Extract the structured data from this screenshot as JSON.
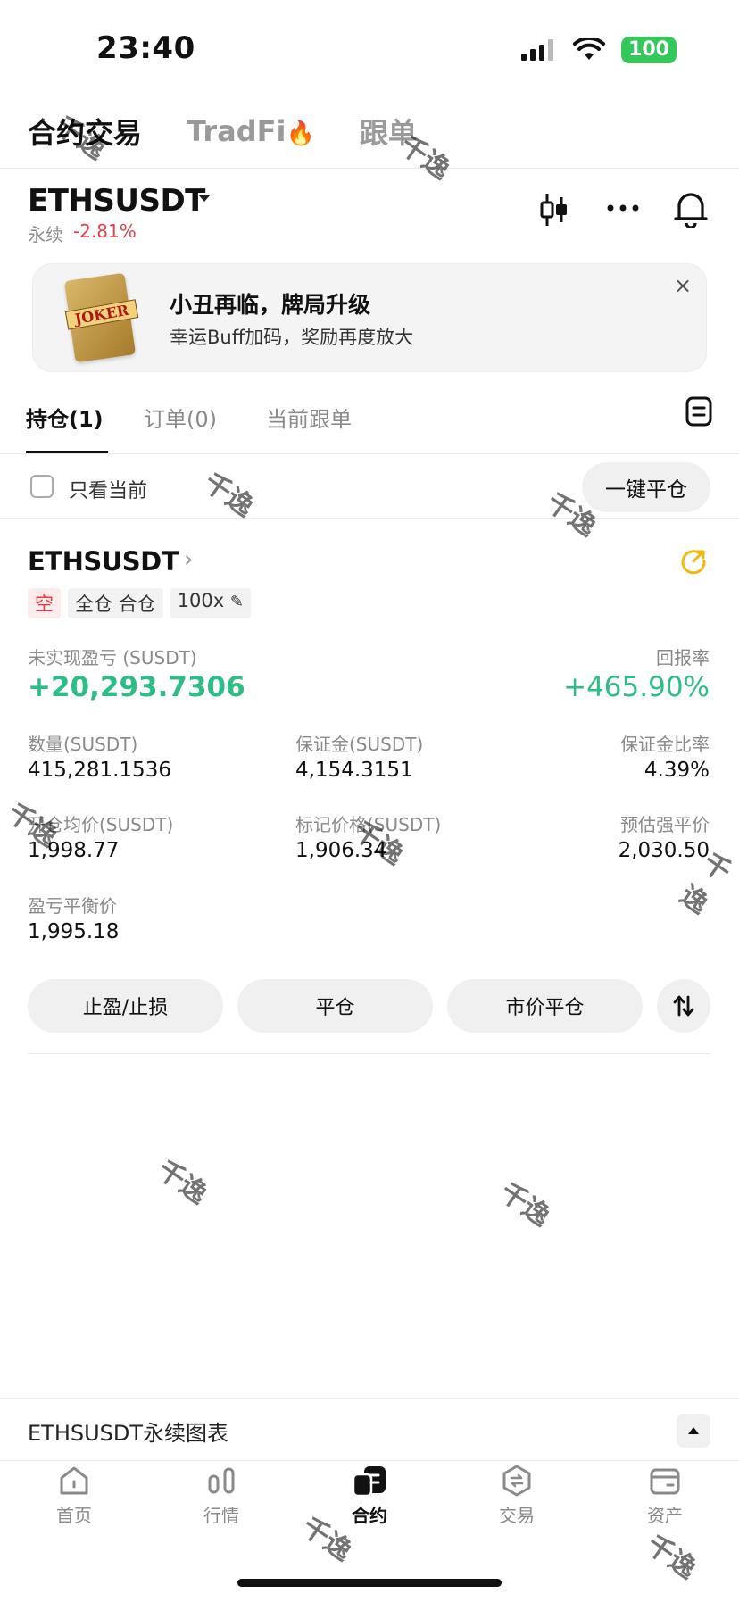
{
  "status_bar": {
    "time": "23:40",
    "battery": "100"
  },
  "top_tabs": [
    {
      "label": "合约交易"
    },
    {
      "label": "TradFi"
    },
    {
      "label": "跟单"
    }
  ],
  "symbol_header": {
    "symbol": "ETHSUSDT",
    "contract_type": "永续",
    "change": "-2.81%"
  },
  "banner": {
    "title": "小丑再临，牌局升级",
    "subtitle": "幸运Buff加码，奖励再度放大",
    "image_text": "JOKER",
    "close": "×"
  },
  "sub_tabs": [
    {
      "label": "持仓(1)"
    },
    {
      "label": "订单(0)"
    },
    {
      "label": "当前跟单"
    }
  ],
  "filter": {
    "label": "只看当前",
    "close_all": "一键平仓"
  },
  "position": {
    "symbol": "ETHSUSDT",
    "tags": {
      "side": "空",
      "margin_mode": "全仓 合仓",
      "leverage": "100x"
    },
    "unrealized_pnl_label": "未实现盈亏 (SUSDT)",
    "unrealized_pnl": "+20,293.7306",
    "roe_label": "回报率",
    "roe": "+465.90%",
    "qty_label": "数量(SUSDT)",
    "qty": "415,281.1536",
    "margin_label": "保证金(SUSDT)",
    "margin": "4,154.3151",
    "margin_ratio_label": "保证金比率",
    "margin_ratio": "4.39%",
    "entry_label": "开仓均价(SUSDT)",
    "entry": "1,998.77",
    "mark_label": "标记价格(SUSDT)",
    "mark": "1,906.34",
    "liq_label": "预估强平价",
    "liq": "2,030.50",
    "breakeven_label": "盈亏平衡价",
    "breakeven": "1,995.18"
  },
  "actions": {
    "tpsl": "止盈/止损",
    "close": "平仓",
    "market_close": "市价平仓"
  },
  "chart_bar": {
    "label": "ETHSUSDT永续图表"
  },
  "bottom_nav": [
    {
      "label": "首页",
      "icon": "home-icon"
    },
    {
      "label": "行情",
      "icon": "market-icon"
    },
    {
      "label": "合约",
      "icon": "futures-icon"
    },
    {
      "label": "交易",
      "icon": "trade-icon"
    },
    {
      "label": "资产",
      "icon": "wallet-icon"
    }
  ],
  "watermark": "千逸",
  "colors": {
    "up": "#2ebd85",
    "down": "#e5404a",
    "accent": "#f0b90b"
  }
}
